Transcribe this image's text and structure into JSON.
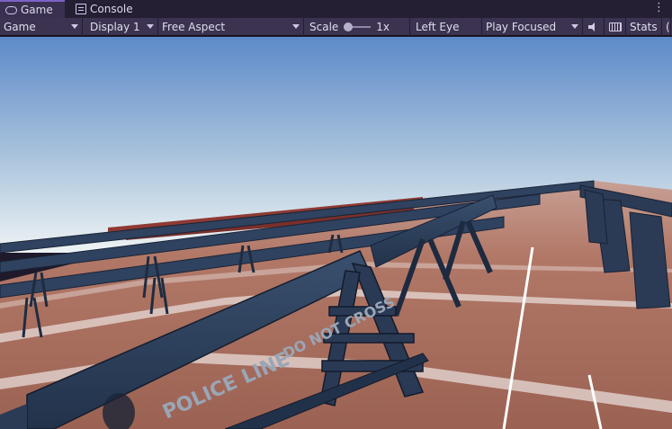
{
  "tabs": [
    {
      "label": "Game",
      "icon": "gamepad-icon",
      "active": true
    },
    {
      "label": "Console",
      "icon": "console-icon",
      "active": false
    }
  ],
  "toolbar": {
    "mode": "Game",
    "display": "Display 1",
    "aspect": "Free Aspect",
    "scale_label": "Scale",
    "scale_value": "1x",
    "eye": "Left Eye",
    "play_mode": "Play Focused",
    "stats": "Stats",
    "gizmos_partial": "("
  },
  "scene": {
    "barricade_text_1": "POLICE LINE",
    "barricade_text_2": "DO NOT CROSS"
  },
  "colors": {
    "accent": "#7b62c6",
    "toolbar_bg": "#3b3350",
    "tabbar_bg": "#241f33",
    "sky_top": "#5f8ccb",
    "sky_horizon": "#e6eef3",
    "track": "#b07564",
    "barricade": "#2b3a52"
  }
}
